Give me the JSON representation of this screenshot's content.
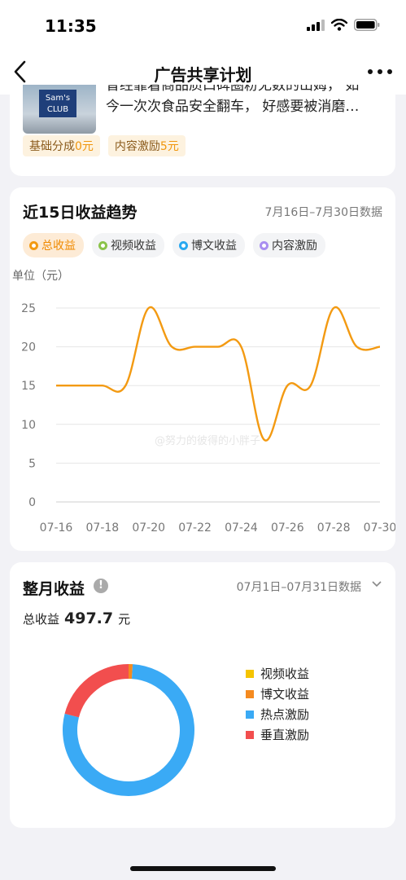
{
  "status_bar": {
    "time": "11:35"
  },
  "nav": {
    "title": "广告共享计划"
  },
  "article": {
    "line1": "曾经靠着商品质口碑圈粉无数的山姆， 如",
    "line2": "今一次次食品安全翻车， 好感要被消磨…",
    "thumb_text": "Sam's CLUB",
    "tags": [
      {
        "label": "基础分成",
        "value": "0元"
      },
      {
        "label": "内容激励",
        "value": "5元"
      }
    ]
  },
  "trend": {
    "title": "近15日收益趋势",
    "date_range": "7月16日–7月30日数据",
    "pills": [
      {
        "label": "总收益",
        "color": "#f39a12"
      },
      {
        "label": "视频收益",
        "color": "#8bc34a"
      },
      {
        "label": "博文收益",
        "color": "#29a8f0"
      },
      {
        "label": "内容激励",
        "color": "#a98ef0"
      }
    ],
    "unit": "单位（元）"
  },
  "chart_data": [
    {
      "type": "line",
      "title": "",
      "x": [
        "07-16",
        "07-17",
        "07-18",
        "07-19",
        "07-20",
        "07-21",
        "07-22",
        "07-23",
        "07-24",
        "07-25",
        "07-26",
        "07-27",
        "07-28",
        "07-29",
        "07-30"
      ],
      "x_tick_labels": [
        "07-16",
        "07-18",
        "07-20",
        "07-22",
        "07-24",
        "07-26",
        "07-28",
        "07-30"
      ],
      "series": [
        {
          "name": "总收益",
          "values": [
            15,
            15,
            15,
            15,
            25,
            20,
            20,
            20,
            20,
            8,
            15,
            15,
            25,
            20,
            20
          ],
          "color": "#f39a12"
        }
      ],
      "ylim": [
        0,
        25
      ],
      "yticks": [
        0,
        5,
        10,
        15,
        20,
        25
      ],
      "grid": true
    },
    {
      "type": "pie",
      "title": "",
      "series": [
        {
          "name": "视频收益",
          "value": 0,
          "color": "#f5c400"
        },
        {
          "name": "博文收益",
          "value": 1,
          "color": "#f58a1f"
        },
        {
          "name": "热点激励",
          "value": 78,
          "color": "#3aaaf5"
        },
        {
          "name": "垂直激励",
          "value": 21,
          "color": "#f24e4e"
        }
      ]
    }
  ],
  "watermark": "@努力的彼得的小胖子",
  "monthly": {
    "title": "整月收益",
    "info_icon": "!",
    "date_range": "07月1日–07月31日数据",
    "total_label": "总收益",
    "total_value": "497.7",
    "total_unit": "元"
  }
}
